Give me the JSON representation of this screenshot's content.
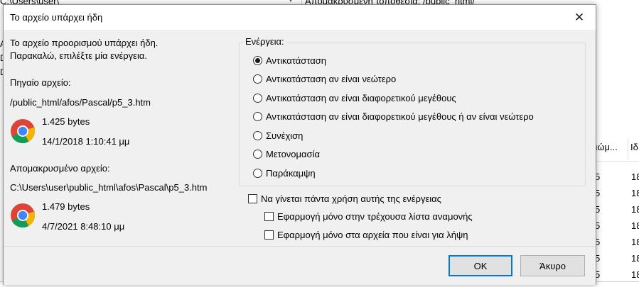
{
  "background": {
    "local_path": "C:\\Users\\user\\",
    "remote_path": "Απομακρυσμένη τοποθεσία: /public_html/",
    "column_headers": [
      "αιώμ...",
      "Ιδ"
    ],
    "rows": [
      {
        "a": "5",
        "b": "18"
      },
      {
        "a": "5",
        "b": "18"
      },
      {
        "a": "5",
        "b": "18"
      },
      {
        "a": "5",
        "b": "18"
      },
      {
        "a": "5",
        "b": "18"
      },
      {
        "a": "5",
        "b": "18"
      },
      {
        "a": "5",
        "b": "18"
      },
      {
        "a": "5",
        "b": "18"
      }
    ],
    "left_letters": [
      "A",
      "D",
      "D"
    ]
  },
  "dialog": {
    "title": "Το αρχείο υπάρχει ήδη",
    "message_line1": "Το αρχείο προορισμού υπάρχει ήδη.",
    "message_line2": "Παρακαλώ, επιλέξτε μία ενέργεια.",
    "source": {
      "heading": "Πηγαίο αρχείο:",
      "path": "/public_html/afos/Pascal/p5_3.htm",
      "size": "1.425 bytes",
      "date": "14/1/2018 1:10:41 μμ",
      "icon": "chrome-icon"
    },
    "remote": {
      "heading": "Απομακρυσμένο αρχείο:",
      "path": "C:\\Users\\user\\public_html\\afos\\Pascal\\p5_3.htm",
      "size": "1.479 bytes",
      "date": "4/7/2021 8:48:10 μμ",
      "icon": "chrome-icon"
    },
    "action_caption": "Ενέργεια:",
    "actions": [
      {
        "label": "Αντικατάσταση",
        "checked": true
      },
      {
        "label": "Αντικατάσταση αν είναι νεώτερο",
        "checked": false
      },
      {
        "label": "Αντικατάσταση αν είναι διαφορετικού μεγέθους",
        "checked": false
      },
      {
        "label": "Αντικατάσταση αν είναι διαφορετικού μεγέθους ή αν είναι νεώτερο",
        "checked": false
      },
      {
        "label": "Συνέχιση",
        "checked": false
      },
      {
        "label": "Μετονομασία",
        "checked": false
      },
      {
        "label": "Παράκαμψη",
        "checked": false
      }
    ],
    "always_use": {
      "label": "Να γίνεται πάντα χρήση αυτής της ενέργειας",
      "checked": false
    },
    "apply_current_queue": {
      "label": "Εφαρμογή μόνο στην τρέχουσα λίστα αναμονής",
      "checked": false
    },
    "apply_downloads": {
      "label": "Εφαρμογή μόνο στα αρχεία που είναι για λήψη",
      "checked": false
    },
    "ok_label": "OK",
    "cancel_label": "Άκυρο",
    "close_glyph": "✕",
    "accent_color": "#0078d7"
  }
}
